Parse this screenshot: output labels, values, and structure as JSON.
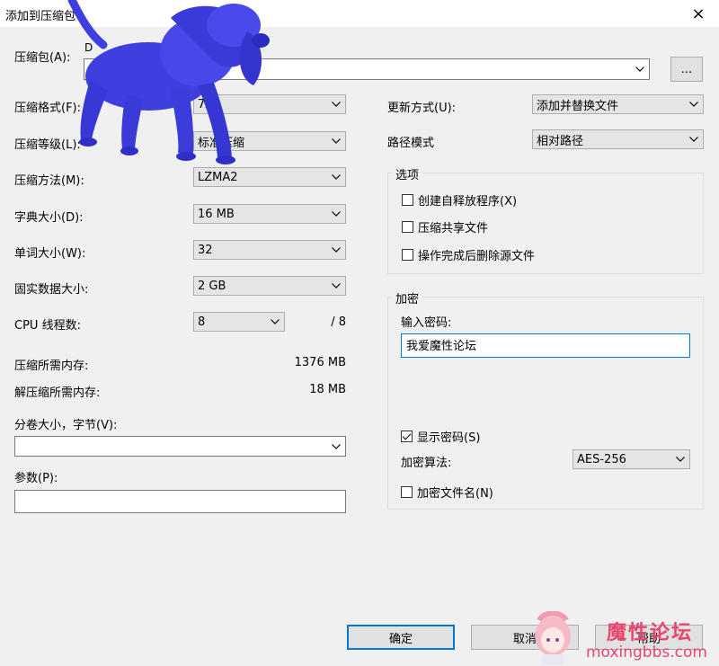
{
  "window": {
    "title": "添加到压缩包",
    "close_icon": "×"
  },
  "archive": {
    "label": "压缩包(A):",
    "path_value": "D",
    "browse_label": "..."
  },
  "left": {
    "format": {
      "label": "压缩格式(F):",
      "value": "7z"
    },
    "level": {
      "label": "压缩等级(L):",
      "value": "标准压缩"
    },
    "method": {
      "label": "压缩方法(M):",
      "value": "LZMA2"
    },
    "dict": {
      "label": "字典大小(D):",
      "value": "16 MB"
    },
    "word": {
      "label": "单词大小(W):",
      "value": "32"
    },
    "solid": {
      "label": "固实数据大小:",
      "value": "2 GB"
    },
    "cpu": {
      "label": "CPU 线程数:",
      "value": "8",
      "total": "/ 8"
    },
    "mem_compress": {
      "label": "压缩所需内存:",
      "value": "1376 MB"
    },
    "mem_decompress": {
      "label": "解压缩所需内存:",
      "value": "18 MB"
    },
    "volume": {
      "label": "分卷大小，字节(V):",
      "value": ""
    },
    "params": {
      "label": "参数(P):",
      "value": ""
    }
  },
  "right": {
    "update": {
      "label": "更新方式(U):",
      "value": "添加并替换文件"
    },
    "pathmode": {
      "label": "路径模式",
      "value": "相对路径"
    },
    "options": {
      "title": "选项",
      "items": [
        {
          "label": "创建自释放程序(X)",
          "checked": false
        },
        {
          "label": "压缩共享文件",
          "checked": false
        },
        {
          "label": "操作完成后删除源文件",
          "checked": false
        }
      ]
    },
    "encryption": {
      "title": "加密",
      "password_label": "输入密码:",
      "password_value": "我爱魔性论坛",
      "show_password": "显示密码(S)",
      "method_label": "加密算法:",
      "method_value": "AES-256",
      "encrypt_names": "加密文件名(N)"
    }
  },
  "buttons": {
    "ok": "确定",
    "cancel": "取消",
    "help": "帮助"
  },
  "watermark": {
    "title": "魔性论坛",
    "url": "moxingbbs.com"
  },
  "colors": {
    "accent": "#0078d7",
    "dog": "#3f3fe0",
    "watermark": "#e8456f"
  }
}
